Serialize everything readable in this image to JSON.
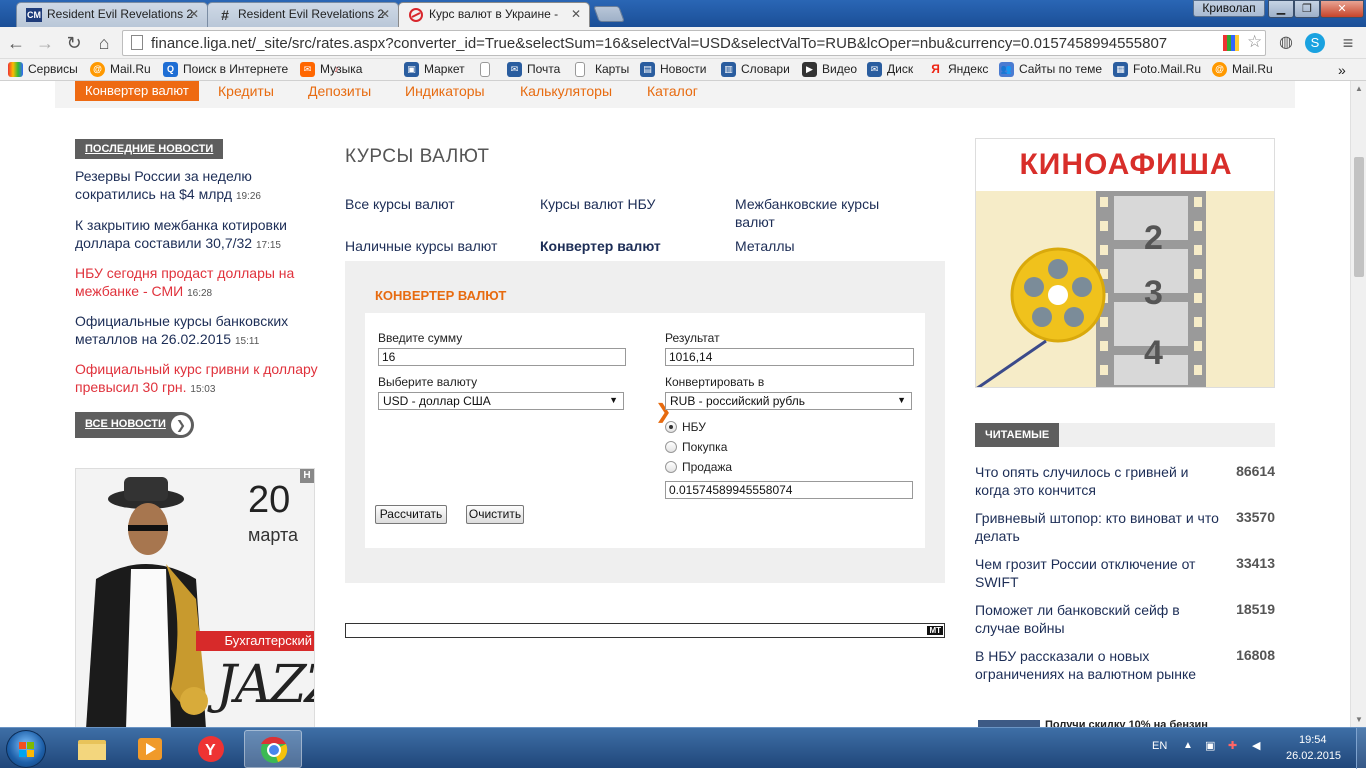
{
  "browser": {
    "tabs": [
      {
        "title": "Resident Evil Revelations 2",
        "icon": "CM"
      },
      {
        "title": "Resident Evil Revelations 2",
        "icon": "#"
      },
      {
        "title": "Курс валют в Украине - ",
        "icon": "liga-icon"
      }
    ],
    "user": "Криволап",
    "url": "finance.liga.net/_site/src/rates.aspx?converter_id=True&selectSum=16&selectVal=USD&selectValTo=RUB&lcOper=nbu&currency=0.0157458994555807",
    "bookmarks": [
      "Сервисы",
      "Mail.Ru",
      "Поиск в Интернете",
      "Музыка",
      "Маркет",
      "Почта",
      "Карты",
      "Новости",
      "Словари",
      "Видео",
      "Диск",
      "Яндекс",
      "Сайты по теме",
      "Foto.Mail.Ru",
      "Mail.Ru"
    ]
  },
  "topnav": {
    "selected": "Конвертер валют",
    "items": [
      "Кредиты",
      "Депозиты",
      "Индикаторы",
      "Калькуляторы",
      "Каталог"
    ]
  },
  "left": {
    "news_tag": "ПОСЛЕДНИЕ НОВОСТИ",
    "news": [
      {
        "text": "Резервы России за неделю сократились на $4 млрд",
        "time": "19:26"
      },
      {
        "text": "К закрытию межбанка котировки доллара составили 30,7/32",
        "time": "17:15"
      },
      {
        "text": "НБУ сегодня продаст доллары на межбанке - СМИ",
        "time": "16:28"
      },
      {
        "text": "Официальные курсы банковских металлов на 26.02.2015",
        "time": "15:11"
      },
      {
        "text": "Официальный курс гривни к доллару превысил 30 грн.",
        "time": "15:03"
      }
    ],
    "all_news": "ВСЕ НОВОСТИ",
    "ad": {
      "day": "20",
      "month": "марта",
      "kicker": "Бухгалтерский",
      "title": "JAZZ",
      "corner": "H"
    }
  },
  "center": {
    "heading": "КУРСЫ ВАЛЮТ",
    "links": [
      "Все курсы валют",
      "Курсы валют НБУ",
      "Межбанковские курсы валют",
      "Наличные курсы валют",
      "Конвертер валют",
      "Металлы"
    ],
    "converter": {
      "title": "КОНВЕРТЕР ВАЛЮТ",
      "sum_label": "Введите сумму",
      "sum_value": "16",
      "result_label": "Результат",
      "result_value": "1016,14",
      "currency_label": "Выберите валюту",
      "currency_value": "USD - доллар США",
      "to_label": "Конвертировать в",
      "to_value": "RUB - российский рубль",
      "radios": [
        "НБУ",
        "Покупка",
        "Продажа"
      ],
      "rate_value": "0.01574589945558074",
      "calc_button": "Рассчитать",
      "clear_button": "Очистить"
    },
    "ad_badge": "MT"
  },
  "right": {
    "banner": "КИНОАФИША",
    "reel_numbers": [
      "2",
      "3",
      "4"
    ],
    "read_tag": "ЧИТАЕМЫЕ",
    "read": [
      {
        "text": "Что опять случилось с гривней и когда это кончится",
        "count": "86614"
      },
      {
        "text": "Гривневый штопор: кто виноват и что делать",
        "count": "33570"
      },
      {
        "text": "Чем грозит России отключение от SWIFT",
        "count": "33413"
      },
      {
        "text": "Поможет ли банковский сейф в случае войны",
        "count": "18519"
      },
      {
        "text": "В НБУ рассказали о новых ограничениях на валютном рынке",
        "count": "16808"
      }
    ],
    "promo_partial": "Получи скидку 10% на бензин"
  },
  "taskbar": {
    "lang": "EN",
    "time": "19:54",
    "date": "26.02.2015"
  }
}
